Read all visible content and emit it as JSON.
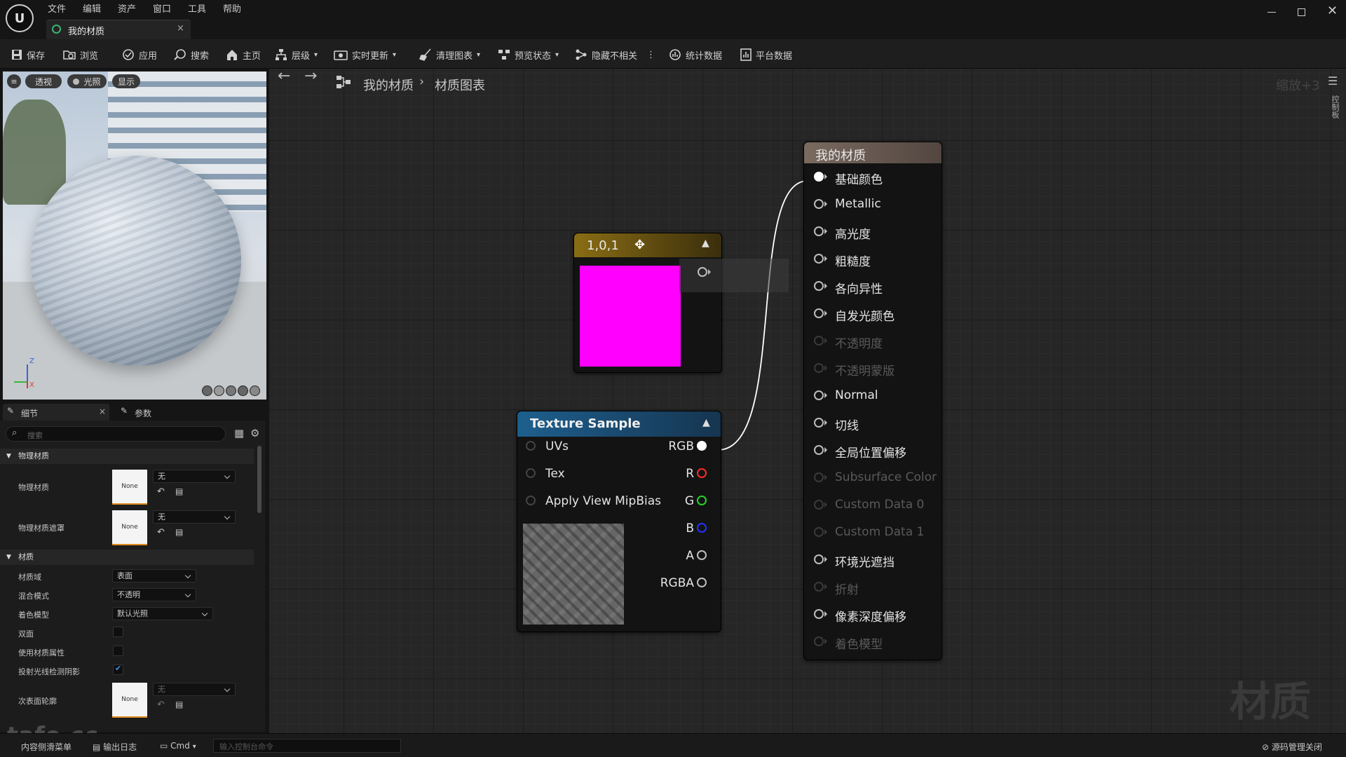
{
  "menu": [
    "文件",
    "编辑",
    "资产",
    "窗口",
    "工具",
    "帮助"
  ],
  "tab": {
    "title": "我的材质"
  },
  "toolbar": {
    "save": "保存",
    "browse": "浏览",
    "apply": "应用",
    "search": "搜索",
    "home": "主页",
    "hierarchy": "层级",
    "live_update": "实时更新",
    "clean_graph": "清理图表",
    "preview_state": "预览状态",
    "hide_unrelated": "隐藏不相关",
    "stats": "统计数据",
    "platform_stats": "平台数据"
  },
  "viewport": {
    "perspective": "透视",
    "lighting": "光照",
    "show": "显示",
    "axis_z": "Z",
    "axis_x": "X"
  },
  "details": {
    "tab_details": "细节",
    "tab_params": "参数",
    "search_placeholder": "搜索",
    "section_physical": "物理材质",
    "physical_material": {
      "label": "物理材质",
      "thumb": "None",
      "value": "无"
    },
    "physical_mask": {
      "label": "物理材质遮罩",
      "thumb": "None",
      "value": "无"
    },
    "section_material": "材质",
    "domain": {
      "label": "材质域",
      "value": "表面"
    },
    "blend_mode": {
      "label": "混合模式",
      "value": "不透明"
    },
    "shading_model": {
      "label": "着色模型",
      "value": "默认光照"
    },
    "two_sided": {
      "label": "双面"
    },
    "use_material_attributes": {
      "label": "使用材质属性"
    },
    "ray_traced_shadows": {
      "label": "投射光线检测阴影"
    },
    "subsurface_profile": {
      "label": "次表面轮廓",
      "thumb": "None",
      "value": "无"
    }
  },
  "graph": {
    "breadcrumb_root": "我的材质",
    "breadcrumb_leaf": "材质图表",
    "zoom": "缩放+3",
    "side_tab": "控制板",
    "watermark": "材质"
  },
  "constant_node": {
    "title": "1,0,1",
    "color": "#ff00ff"
  },
  "texture_node": {
    "title": "Texture Sample",
    "inputs": [
      "UVs",
      "Tex",
      "Apply View MipBias"
    ],
    "outputs": [
      {
        "label": "RGB",
        "color": "#ffffff"
      },
      {
        "label": "R",
        "color": "#ff2a2a"
      },
      {
        "label": "G",
        "color": "#28d228"
      },
      {
        "label": "B",
        "color": "#2233ff"
      },
      {
        "label": "A",
        "color": "#bdbdbd"
      },
      {
        "label": "RGBA",
        "color": "#bdbdbd"
      }
    ]
  },
  "material_node": {
    "title": "我的材质",
    "pins": [
      {
        "label": "基础颜色",
        "active": true,
        "connected": true
      },
      {
        "label": "Metallic",
        "active": true
      },
      {
        "label": "高光度",
        "active": true
      },
      {
        "label": "粗糙度",
        "active": true
      },
      {
        "label": "各向异性",
        "active": true
      },
      {
        "label": "自发光颜色",
        "active": true
      },
      {
        "label": "不透明度",
        "active": false
      },
      {
        "label": "不透明蒙版",
        "active": false
      },
      {
        "label": "Normal",
        "active": true
      },
      {
        "label": "切线",
        "active": true
      },
      {
        "label": "全局位置偏移",
        "active": true
      },
      {
        "label": "Subsurface Color",
        "active": false
      },
      {
        "label": "Custom Data 0",
        "active": false
      },
      {
        "label": "Custom Data 1",
        "active": false
      },
      {
        "label": "环境光遮挡",
        "active": true
      },
      {
        "label": "折射",
        "active": false
      },
      {
        "label": "像素深度偏移",
        "active": true
      },
      {
        "label": "着色模型",
        "active": false
      }
    ]
  },
  "statusbar": {
    "content_drawer": "内容侧滑菜单",
    "output_log": "输出日志",
    "cmd": "Cmd",
    "console_placeholder": "输入控制台命令",
    "source_control": "源码管理关闭"
  },
  "logo_watermark": "tafe.cc"
}
